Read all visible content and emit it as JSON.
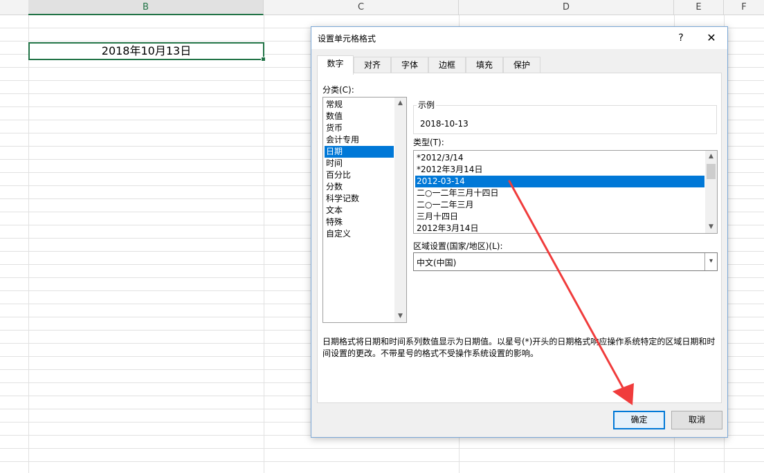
{
  "sheet": {
    "columns": [
      "B",
      "C",
      "D",
      "E",
      "F"
    ],
    "active_cell_value": "2018年10月13日"
  },
  "dialog": {
    "title": "设置单元格格式",
    "help": "?",
    "close": "✕",
    "tabs": [
      "数字",
      "对齐",
      "字体",
      "边框",
      "填充",
      "保护"
    ],
    "category_label": "分类(C):",
    "categories": [
      "常规",
      "数值",
      "货币",
      "会计专用",
      "日期",
      "时间",
      "百分比",
      "分数",
      "科学记数",
      "文本",
      "特殊",
      "自定义"
    ],
    "selected_category": "日期",
    "sample_label": "示例",
    "sample_value": "2018-10-13",
    "type_label": "类型(T):",
    "types": [
      "*2012/3/14",
      "*2012年3月14日",
      "2012-03-14",
      "二○一二年三月十四日",
      "二○一二年三月",
      "三月十四日",
      "2012年3月14日"
    ],
    "selected_type": "2012-03-14",
    "locale_label": "区域设置(国家/地区)(L):",
    "locale_value": "中文(中国)",
    "description": "日期格式将日期和时间系列数值显示为日期值。以星号(*)开头的日期格式响应操作系统特定的区域日期和时间设置的更改。不带星号的格式不受操作系统设置的影响。",
    "ok_label": "确定",
    "cancel_label": "取消"
  },
  "colors": {
    "excel_green": "#217346",
    "selection_blue": "#0078d7",
    "annotation_red": "#f03c3c"
  }
}
